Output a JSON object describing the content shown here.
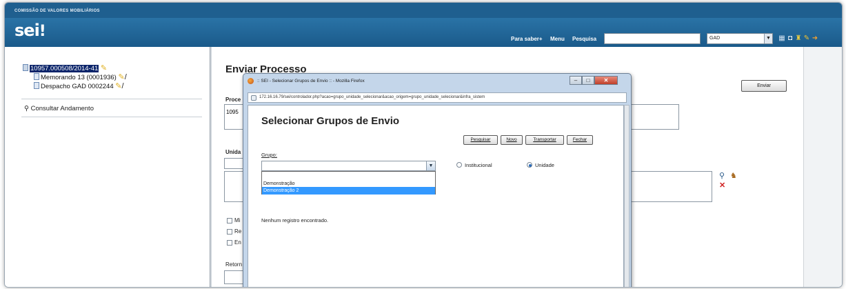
{
  "header": {
    "org_name": "COMISSÃO DE VALORES MOBILIÁRIOS",
    "logo": "sei",
    "links": {
      "para_saber": "Para saber+",
      "menu": "Menu",
      "pesquisa": "Pesquisa"
    },
    "search_value": "",
    "unit_select_value": "GAD",
    "colors": {
      "bar": "#1f5f8f",
      "header": "#2a73a6"
    }
  },
  "left": {
    "process_number": "10957.000508/2014-41",
    "tree_items": [
      {
        "label": "Memorando 13 (0001936)"
      },
      {
        "label": "Despacho GAD 0002244"
      }
    ],
    "consultar_label": "Consultar Andamento"
  },
  "main": {
    "title": "Enviar Processo",
    "enviar_label": "Enviar",
    "partial_labels": {
      "proce": "Proce",
      "num": "1095",
      "unida": "Unida",
      "mi": "Mi",
      "re": "Re",
      "en": "En",
      "retorn": "Retorn"
    }
  },
  "popup": {
    "window_title": ":: SEI - Selecionar Grupos de Envio :: - Mozilla Firefox",
    "url": "172.16.16.79/sei/controlador.php?acao=grupo_unidade_selecionar&acao_origem=grupo_unidade_selecionar&infra_sistem",
    "heading": "Selecionar Grupos de Envio",
    "buttons": {
      "pesquisar": "Pesquisar",
      "novo": "Novo",
      "transportar": "Transportar",
      "fechar": "Fechar"
    },
    "grupo_label": "Grupo:",
    "grupo_options": [
      "Demonstração",
      "Demonstração 2"
    ],
    "radio_institucional": "Institucional",
    "radio_unidade": "Unidade",
    "empty_message": "Nenhum registro encontrado."
  }
}
